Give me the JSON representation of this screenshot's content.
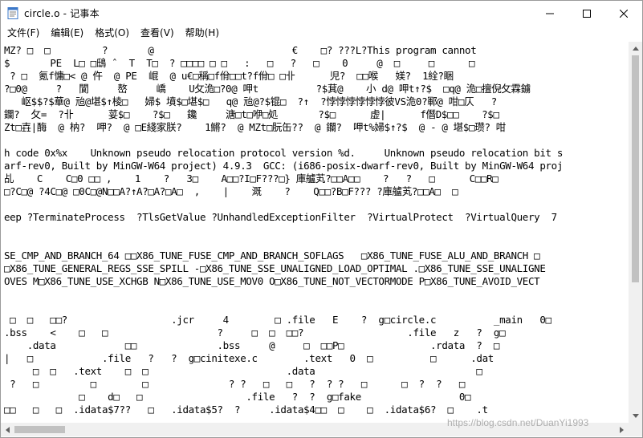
{
  "window": {
    "title": "circle.o - 记事本",
    "minimize_symbol": "—",
    "maximize_symbol": "☐",
    "close_symbol": "✕"
  },
  "menu": [
    "文件(F)",
    "编辑(E)",
    "格式(O)",
    "查看(V)",
    "帮助(H)"
  ],
  "content_lines": [
    "MZ? □  □         ?       @                        €    □? ???L?This program cannot",
    "$       PE  L□ □鴟 ˆ  T  T□  ? □□□□ □ □   :   □   ?   □    0     @  □     □      □",
    " ? □  氪f慵□< @ 仵  @ PE  崐  @ u€□稱□f佾□□t?f佾□ □卝      児?  □□喉   媄?  1絟?睏",
    "?□0@     ?   閬     嶅     嶠    U攵洈□?0@ 呷t          ?$萁@    小 d@ 呷t↑?$  □q@ 洈□擅倪攵霖鐪",
    "   岖$$?$華@ 兘@堪$↑棱□   婦$ 墳$□堪$□   q@ 兘@?$锟□  ?↑  ?悖悖悖悖悖悖彼VS洈0?鄆@ 咁□仄   ?",
    "鑭?  攵=  ?卝      荽$□    ?$□   鑱     溏□t□咿□処       ?$□      虚|      f僭D$□□    ?$□",
    "Zt□壵|酶  @ 枘?  呷?  @ □E綫家朕?    1鱂?  @ MZt□朊缶??  @ 鑭?  呷t%婦$↑?$  @ - @ 堪$□瓒? 咁",
    "",
    "h code 0x%x    Unknown pseudo relocation protocol version %d.     Unknown pseudo relocation bit s",
    "arf-rev0, Built by MinGW-W64 project) 4.9.3  GCC: (i686-posix-dwarf-rev0, Built by MinGW-W64 proj",
    "乩    C    C□0 □□ ,    1    ?   3□    A□□?I□F???□} 庫艫芄?□□A□□    ?   ?   □      C□□R□",
    "□?C□@ ?4C□@ □0C□@N□□A?↑A?□A?□A□  ,    |    溉    ?    Q□□?B□F??? ?庫艫芄?□□A□  □",
    "",
    "eep ?TerminateProcess  ?TlsGetValue ?UnhandledExceptionFilter  ?VirtualProtect  ?VirtualQuery  7",
    "",
    "",
    "SE_CMP_AND_BRANCH_64 □□X86_TUNE_FUSE_CMP_AND_BRANCH_SOFLAGS   □X86_TUNE_FUSE_ALU_AND_BRANCH □",
    "□X86_TUNE_GENERAL_REGS_SSE_SPILL -□X86_TUNE_SSE_UNALIGNED_LOAD_OPTIMAL .□X86_TUNE_SSE_UNALIGNE",
    "OVES M□X86_TUNE_USE_XCHGB N□X86_TUNE_USE_MOV0 O□X86_TUNE_NOT_VECTORMODE P□X86_TUNE_AVOID_VECT",
    "",
    "",
    " □  □   □□?                  .jcr     4        □ .file   E    ?  g□circle.c          _main   0□",
    ".bss    <    □   □                   ?     □  □  □□?                  .file   z   ?  g□",
    "    .data            □□              .bss     @     □  □□P□               .rdata  ?  □",
    "|   □            .file   ?   ?  g□cinitexe.c        .text   0  □          □      .dat",
    "     □  □   .text    □  □                        .data                            □",
    " ?   □         □        □              ? ?   □   □   ?  ? ?   □      □  ?  ?   □",
    "             □    d□   □                  .file   ?  ?  g□fake                 0□",
    "□□   □   □  .idata$7??   □   .idata$5?  ?     .idata$4□□  □    □  .idata$6?  □    .t"
  ],
  "watermark": "https://blog.csdn.net/DuanYi1993"
}
